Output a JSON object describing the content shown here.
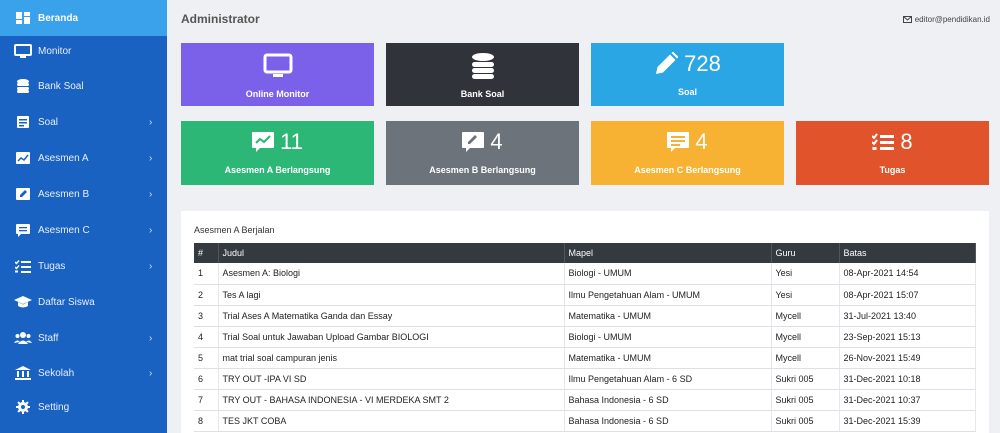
{
  "sidebar": {
    "items": [
      {
        "label": "Beranda",
        "icon": "dashboard-icon",
        "chevron": false,
        "active": true
      },
      {
        "label": "Monitor",
        "icon": "monitor-icon",
        "chevron": false
      },
      {
        "label": "Bank Soal",
        "icon": "database-icon",
        "chevron": false
      },
      {
        "label": "Soal",
        "icon": "list-icon",
        "chevron": true
      },
      {
        "label": "Asesmen A",
        "icon": "chart-icon",
        "chevron": true
      },
      {
        "label": "Asesmen B",
        "icon": "edit-square-icon",
        "chevron": true
      },
      {
        "label": "Asesmen C",
        "icon": "message-icon",
        "chevron": true
      },
      {
        "label": "Tugas",
        "icon": "tasks-icon",
        "chevron": true
      },
      {
        "label": "Daftar Siswa",
        "icon": "graduation-cap-icon",
        "chevron": false
      },
      {
        "label": "Staff",
        "icon": "users-icon",
        "chevron": true
      },
      {
        "label": "Sekolah",
        "icon": "school-icon",
        "chevron": true
      },
      {
        "label": "Setting",
        "icon": "gear-icon",
        "chevron": false
      }
    ]
  },
  "header": {
    "title": "Administrator",
    "email": "editor@pendidikan.id"
  },
  "cards": [
    {
      "caption": "Online Monitor",
      "number": "",
      "color": "#7b61ea",
      "icon": "monitor-icon"
    },
    {
      "caption": "Bank Soal",
      "number": "",
      "color": "#30343a",
      "icon": "database-icon"
    },
    {
      "caption": "Soal",
      "number": "728",
      "color": "#2aa6e5",
      "icon": "pencil-icon"
    },
    {
      "caption": "Asesmen A Berlangsung",
      "number": "11",
      "color": "#2db777",
      "icon": "chart-icon"
    },
    {
      "caption": "Asesmen B Berlangsung",
      "number": "4",
      "color": "#6c737b",
      "icon": "edit-square-icon"
    },
    {
      "caption": "Asesmen C Berlangsung",
      "number": "4",
      "color": "#f7b234",
      "icon": "message-icon"
    },
    {
      "caption": "Tugas",
      "number": "8",
      "color": "#e1542b",
      "icon": "tasks-icon"
    }
  ],
  "panel": {
    "title": "Asesmen A Berjalan",
    "columns": [
      "#",
      "Judul",
      "Mapel",
      "Guru",
      "Batas"
    ],
    "rows": [
      [
        "1",
        "Asesmen A: Biologi",
        "Biologi - UMUM",
        "Yesi",
        "08-Apr-2021 14:54"
      ],
      [
        "2",
        "Tes A lagi",
        "Ilmu Pengetahuan Alam - UMUM",
        "Yesi",
        "08-Apr-2021 15:07"
      ],
      [
        "3",
        "Trial Ases A Matematika Ganda dan Essay",
        "Matematika - UMUM",
        "Mycell",
        "31-Jul-2021 13:40"
      ],
      [
        "4",
        "Trial Soal untuk Jawaban Upload Gambar BIOLOGI",
        "Biologi - UMUM",
        "Mycell",
        "23-Sep-2021 15:13"
      ],
      [
        "5",
        "mat trial soal campuran jenis",
        "Matematika - UMUM",
        "Mycell",
        "26-Nov-2021 15:49"
      ],
      [
        "6",
        "TRY OUT -IPA VI SD",
        "Ilmu Pengetahuan Alam - 6 SD",
        "Sukri 005",
        "31-Dec-2021 10:18"
      ],
      [
        "7",
        "TRY OUT - BAHASA INDONESIA - VI MERDEKA SMT 2",
        "Bahasa Indonesia - 6 SD",
        "Sukri 005",
        "31-Dec-2021 10:37"
      ],
      [
        "8",
        "TES JKT COBA",
        "Bahasa Indonesia - 6 SD",
        "Sukri 005",
        "31-Dec-2021 15:39"
      ]
    ]
  }
}
